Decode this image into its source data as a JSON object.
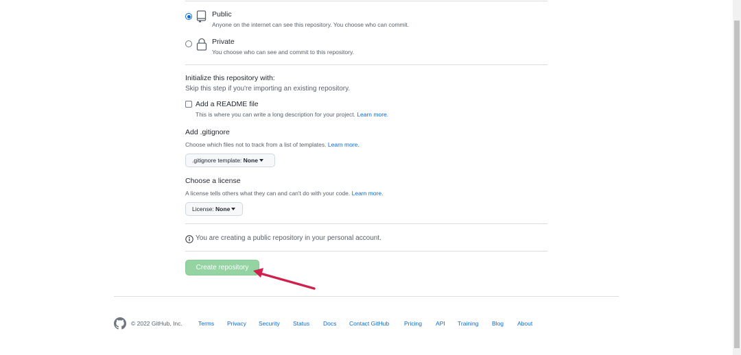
{
  "visibility": {
    "public": {
      "label": "Public",
      "description": "Anyone on the internet can see this repository. You choose who can commit.",
      "selected": true
    },
    "private": {
      "label": "Private",
      "description": "You choose who can see and commit to this repository.",
      "selected": false
    }
  },
  "initialize": {
    "heading": "Initialize this repository with:",
    "subtext": "Skip this step if you're importing an existing repository.",
    "readme": {
      "label": "Add a README file",
      "description": "This is where you can write a long description for your project.",
      "learn_more": "Learn more.",
      "checked": false
    }
  },
  "gitignore": {
    "heading": "Add .gitignore",
    "description": "Choose which files not to track from a list of templates.",
    "learn_more": "Learn more.",
    "dropdown_prefix": ".gitignore template:",
    "dropdown_value": "None"
  },
  "license": {
    "heading": "Choose a license",
    "description": "A license tells others what they can and can't do with your code.",
    "learn_more": "Learn more.",
    "dropdown_prefix": "License:",
    "dropdown_value": "None"
  },
  "notice": {
    "icon": "info-icon",
    "text": "You are creating a public repository in your personal account."
  },
  "create_button": {
    "label": "Create repository",
    "color": "#94d3a2"
  },
  "annotation": {
    "arrow_color": "#d0214c"
  },
  "footer": {
    "copyright": "© 2022 GitHub, Inc.",
    "links": [
      "Terms",
      "Privacy",
      "Security",
      "Status",
      "Docs",
      "Contact GitHub",
      "Pricing",
      "API",
      "Training",
      "Blog",
      "About"
    ]
  },
  "colors": {
    "accent": "#0969da",
    "text": "#24292f",
    "muted": "#57606a"
  }
}
